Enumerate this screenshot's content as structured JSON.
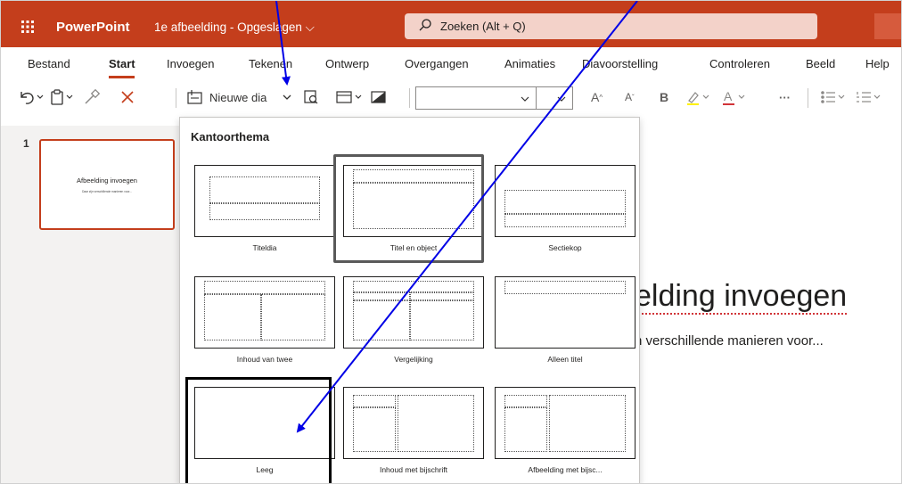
{
  "app": {
    "name": "PowerPoint",
    "document_title": "1e afbeelding - Opgeslagen ⌵",
    "search_placeholder": "Zoeken (Alt + Q)"
  },
  "ribbon_tabs": [
    {
      "label": "Bestand"
    },
    {
      "label": "Start"
    },
    {
      "label": "Invoegen"
    },
    {
      "label": "Tekenen"
    },
    {
      "label": "Ontwerp"
    },
    {
      "label": "Overgangen"
    },
    {
      "label": "Animaties"
    },
    {
      "label": "Diavoorstelling"
    },
    {
      "label": "Controleren"
    },
    {
      "label": "Beeld"
    },
    {
      "label": "Help"
    }
  ],
  "toolbar": {
    "new_slide_label": "Nieuwe dia",
    "more_label": "···"
  },
  "slides_pane": {
    "slide_number": "1",
    "thumb_title": "Afbeelding invoegen",
    "thumb_subtitle": "Daar zijn verschillende manieren voor..."
  },
  "canvas": {
    "title_fragment": "elding invoegen",
    "subtitle_fragment": "n verschillende manieren voor..."
  },
  "layout_menu": {
    "header": "Kantoorthema",
    "layouts": [
      {
        "label": "Titeldia"
      },
      {
        "label": "Titel en object"
      },
      {
        "label": "Sectiekop"
      },
      {
        "label": "Inhoud van twee"
      },
      {
        "label": "Vergelijking"
      },
      {
        "label": "Alleen titel"
      },
      {
        "label": "Leeg"
      },
      {
        "label": "Inhoud met bijschrift"
      },
      {
        "label": "Afbeelding met bijsc..."
      }
    ]
  },
  "colors": {
    "brand": "#c43e1c",
    "arrow": "#0000e6"
  }
}
